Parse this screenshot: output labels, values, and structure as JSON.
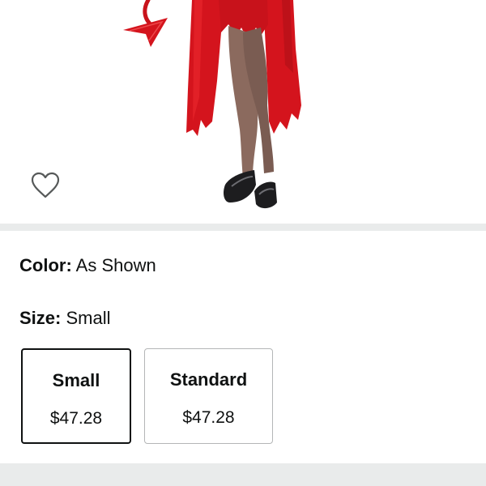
{
  "product": {
    "color_label": "Color:",
    "color_value": "As Shown",
    "size_label": "Size:",
    "size_value": "Small",
    "sizes": [
      {
        "name": "Small",
        "price": "$47.28",
        "selected": true
      },
      {
        "name": "Standard",
        "price": "$47.28",
        "selected": false
      }
    ]
  },
  "icons": {
    "wishlist": "heart-outline-icon"
  },
  "colors": {
    "costume_red": "#d4141d",
    "divider_gray": "#e9ebeb",
    "selected_border": "#0f1111",
    "unselected_border": "#b4b6b7"
  }
}
